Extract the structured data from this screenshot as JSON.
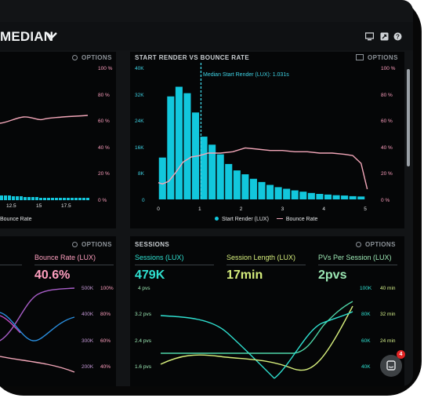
{
  "header": {
    "title": "MEDIAN",
    "icons": [
      "monitor-icon",
      "share-icon",
      "help-icon"
    ]
  },
  "left_top": {
    "options_label": "OPTIONS",
    "y_right_ticks": [
      "100 %",
      "80 %",
      "60 %",
      "40 %",
      "20 %",
      "0 %"
    ],
    "x_ticks": [
      "12.5",
      "15",
      "17.5"
    ],
    "legend_bounce": "Bounce Rate"
  },
  "render_chart": {
    "title": "START RENDER VS BOUNCE RATE",
    "options_label": "OPTIONS",
    "median_label": "Median Start Render (LUX): 1.031s",
    "y_left_ticks": [
      "40K",
      "32K",
      "24K",
      "16K",
      "8K",
      "0"
    ],
    "y_right_ticks": [
      "100 %",
      "80 %",
      "60 %",
      "40 %",
      "20 %",
      "0 %"
    ],
    "x_ticks": [
      "0",
      "1",
      "2",
      "3",
      "4",
      "5"
    ],
    "legend_render": "Start Render (LUX)",
    "legend_bounce": "Bounce Rate",
    "colors": {
      "bars": "#12c7dc",
      "bounce": "#f2a6b8"
    }
  },
  "chart_data": {
    "type": "bar",
    "title": "START RENDER VS BOUNCE RATE",
    "x": [
      0.1,
      0.3,
      0.5,
      0.7,
      0.9,
      1.1,
      1.3,
      1.5,
      1.7,
      1.9,
      2.1,
      2.3,
      2.5,
      2.7,
      2.9,
      3.1,
      3.3,
      3.5,
      3.7,
      3.9,
      4.1,
      4.3,
      4.5,
      4.7,
      4.9
    ],
    "series": [
      {
        "name": "Start Render (LUX)",
        "type": "bar",
        "axis": "left",
        "values": [
          13000,
          32000,
          35000,
          33000,
          27000,
          19500,
          17000,
          14000,
          11000,
          9000,
          7800,
          6400,
          5400,
          4500,
          3800,
          3300,
          2800,
          2400,
          2000,
          1700,
          1500,
          1300,
          1200,
          1000,
          900
        ]
      },
      {
        "name": "Bounce Rate",
        "type": "line",
        "axis": "right",
        "x": [
          0,
          0.1,
          0.25,
          0.4,
          0.6,
          0.8,
          1.0,
          1.2,
          1.5,
          1.8,
          2.1,
          2.4,
          2.7,
          3.0,
          3.3,
          3.6,
          3.9,
          4.2,
          4.5,
          4.7,
          4.9,
          5.05
        ],
        "values": [
          13,
          12,
          14,
          20,
          29,
          33,
          34,
          36,
          36,
          37,
          40,
          39,
          38,
          38,
          37,
          37,
          36,
          36,
          35,
          34,
          28,
          8
        ]
      }
    ],
    "ylim_left": [
      0,
      40000
    ],
    "ylim_right": [
      0,
      100
    ],
    "xlim": [
      0,
      5
    ]
  },
  "sessions": {
    "title": "SESSIONS",
    "options_label": "OPTIONS",
    "metrics": [
      {
        "label": "Sessions (LUX)",
        "value": "479K"
      },
      {
        "label": "Session Length (LUX)",
        "value": "17min"
      },
      {
        "label": "PVs Per Session (LUX)",
        "value": "2pvs"
      }
    ],
    "y_left_ticks": [
      "4 pvs",
      "3.2 pvs",
      "2.4 pvs",
      "1.6 pvs"
    ],
    "y_right_ticks_a": [
      "100K",
      "80K",
      "60K",
      "40K"
    ],
    "y_right_ticks_b": [
      "40 min",
      "32 min",
      "24 min"
    ],
    "colors": {
      "sessions": "#2fe0d0",
      "length": "#d6ee7c",
      "pvs": "#9ce8b4"
    }
  },
  "left_bottom": {
    "options_label": "OPTIONS",
    "metric_label": "Bounce Rate (LUX)",
    "metric_value": "40.6%",
    "y_ticks_a": [
      "500K",
      "400K",
      "300K",
      "200K"
    ],
    "y_ticks_b": [
      "100%",
      "80%",
      "60%",
      "40%"
    ]
  },
  "chat": {
    "badge": "4"
  }
}
